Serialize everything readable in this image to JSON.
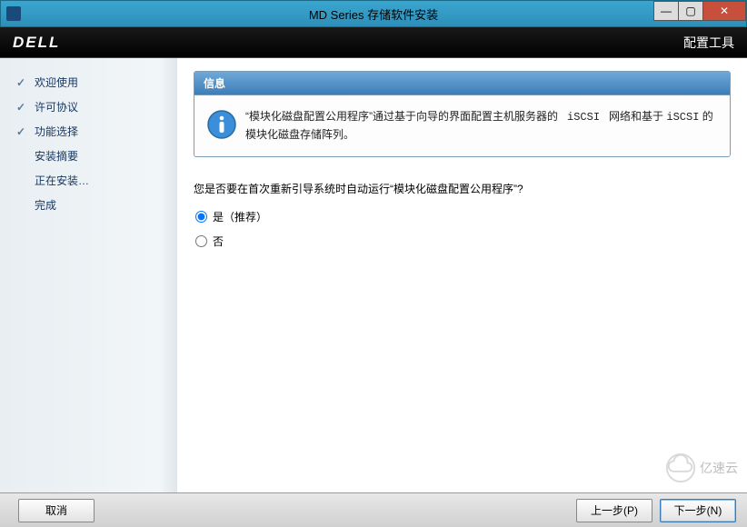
{
  "window": {
    "title": "MD Series 存储软件安装"
  },
  "brand": {
    "logo": "DELL",
    "section": "配置工具"
  },
  "sidebar": {
    "items": [
      {
        "label": "欢迎使用",
        "done": true
      },
      {
        "label": "许可协议",
        "done": true
      },
      {
        "label": "功能选择",
        "done": true
      },
      {
        "label": "安装摘要",
        "done": false
      },
      {
        "label": "正在安装…",
        "done": false
      },
      {
        "label": "完成",
        "done": false
      }
    ]
  },
  "info": {
    "header": "信息",
    "text_prefix": "“模块化磁盘配置公用程序”通过基于向导的界面配置主机服务器的",
    "code1": "iSCSI",
    "text_mid": "网络和基于",
    "code2": "iSCSI",
    "text_suffix": "的模块化磁盘存储阵列。"
  },
  "question": "您是否要在首次重新引导系统时自动运行“模块化磁盘配置公用程序”?",
  "radio": {
    "yes": "是（推荐）",
    "no": "否",
    "selected": "yes"
  },
  "footer": {
    "cancel": "取消",
    "back": "上一步(P)",
    "next": "下一步(N)"
  },
  "watermark": "亿速云"
}
